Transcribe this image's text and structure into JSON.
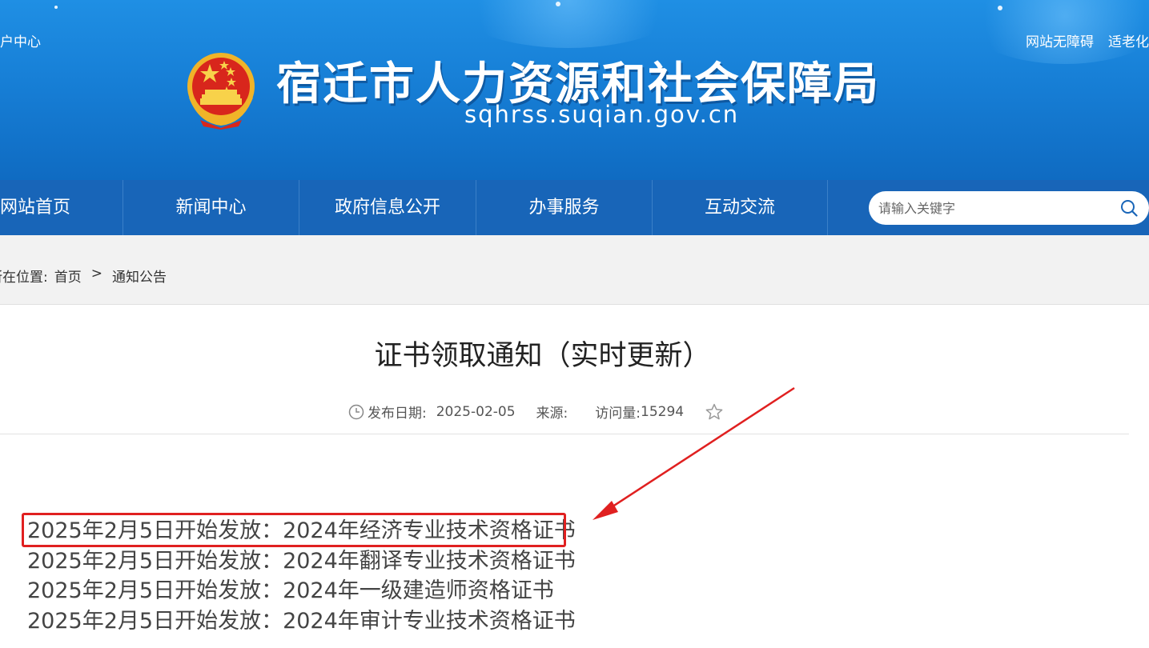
{
  "header": {
    "user_center": "户中心",
    "accessibility_link": "网站无障碍",
    "elderly_mode_link": "适老化",
    "site_title": "宿迁市人力资源和社会保障局",
    "site_domain": "sqhrss.suqian.gov.cn"
  },
  "nav": {
    "items": [
      {
        "label": "网站首页"
      },
      {
        "label": "新闻中心"
      },
      {
        "label": "政府信息公开"
      },
      {
        "label": "办事服务"
      },
      {
        "label": "互动交流"
      }
    ],
    "search_placeholder": "请输入关键字"
  },
  "breadcrumb": {
    "prefix": "所在位置:",
    "home": "首页",
    "separator": ">",
    "current": "通知公告"
  },
  "article": {
    "title": "证书领取通知（实时更新）",
    "publish_date_label": "发布日期:",
    "publish_date": "2025-02-05",
    "source_label": "来源:",
    "visits_label": "访问量:",
    "visits": "15294",
    "notices": [
      "2025年2月5日开始发放：2024年经济专业技术资格证书",
      "2025年2月5日开始发放：2024年翻译专业技术资格证书",
      "2025年2月5日开始发放：2024年一级建造师资格证书",
      "2025年2月5日开始发放：2024年审计专业技术资格证书"
    ]
  },
  "colors": {
    "banner": "#177fd6",
    "nav": "#1865b8",
    "highlight": "#e02020"
  }
}
